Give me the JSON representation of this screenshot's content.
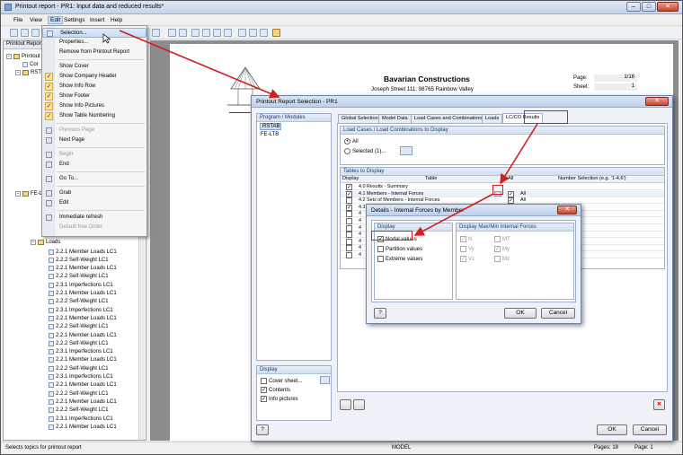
{
  "app": {
    "title": "Printout report - PR1: Input data and reduced results*"
  },
  "menubar": [
    "File",
    "View",
    "Edit",
    "Settings",
    "Insert",
    "Help"
  ],
  "left_panel": {
    "header": "Printout Report",
    "tree": [
      {
        "label": "Printout",
        "kind": "folder"
      },
      {
        "label": "Cor",
        "kind": "doc"
      },
      {
        "label": "RST",
        "kind": "folder"
      },
      {
        "label": "FE-L",
        "kind": "folder"
      },
      {
        "label": "Loads",
        "kind": "folder"
      }
    ],
    "load_items": [
      "2.2.1 Member Loads LC1",
      "2.2.2 Self-Weight LC1",
      "2.2.1 Member Loads LC1",
      "2.2.2 Self-Weight LC1",
      "2.3.1 Imperfections LC1",
      "2.2.1 Member Loads LC1",
      "2.2.2 Self-Weight LC1",
      "2.3.1 Imperfections LC1",
      "2.2.1 Member Loads LC1",
      "2.2.2 Self-Weight LC1",
      "2.2.1 Member Loads LC1",
      "2.2.2 Self-Weight LC1",
      "2.3.1 Imperfections LC1",
      "2.2.1 Member Loads LC1",
      "2.2.2 Self-Weight LC1",
      "2.3.1 Imperfections LC1",
      "2.2.1 Member Loads LC1",
      "2.2.2 Self-Weight LC1",
      "2.2.1 Member Loads LC1",
      "2.2.2 Self-Weight LC1",
      "2.3.1 Imperfections LC1",
      "2.2.1 Member Loads LC1"
    ]
  },
  "edit_menu": [
    {
      "label": "Selection...",
      "state": "hl",
      "icon": true
    },
    {
      "label": "Properties...",
      "state": "normal"
    },
    {
      "label": "Remove from Printout Report",
      "state": "normal"
    },
    {
      "sep": true
    },
    {
      "label": "Show Cover",
      "state": "normal"
    },
    {
      "label": "Show Company Header",
      "state": "check"
    },
    {
      "label": "Show Info Row",
      "state": "check"
    },
    {
      "label": "Show Footer",
      "state": "check"
    },
    {
      "label": "Show Info Pictures",
      "state": "check"
    },
    {
      "label": "Show Table Numbering",
      "state": "check"
    },
    {
      "sep": true
    },
    {
      "label": "Previous Page",
      "state": "dis",
      "icon": true
    },
    {
      "label": "Next Page",
      "state": "normal",
      "icon": true
    },
    {
      "sep": true
    },
    {
      "label": "Begin",
      "state": "dis",
      "icon": true
    },
    {
      "label": "End",
      "state": "normal",
      "icon": true
    },
    {
      "sep": true
    },
    {
      "label": "Go To...",
      "state": "normal",
      "icon": true
    },
    {
      "sep": true
    },
    {
      "label": "Grab",
      "state": "normal",
      "icon": true
    },
    {
      "label": "Edit",
      "state": "normal",
      "icon": true
    },
    {
      "sep": true
    },
    {
      "label": "Immediate refresh",
      "state": "normal",
      "icon": true
    },
    {
      "label": "Default free Order",
      "state": "dis"
    }
  ],
  "paper": {
    "company": "Bavarian Constructions",
    "address": "Joseph Street 111; 98765 Rainbow Valley",
    "page_label": "Page:",
    "page_value": "1/18",
    "sheet_label": "Sheet:",
    "sheet_value": "1"
  },
  "dialog": {
    "title": "Printout Report Selection - PR1",
    "modules_header": "Program / Modules",
    "modules": [
      "RSTAB",
      "FE-LTB"
    ],
    "tabs": [
      "Global Selection",
      "Model Data",
      "Load Cases and Combinations",
      "Loads",
      "LC/CO Results"
    ],
    "lc_header": "Load Cases / Load Combinations to Display",
    "radio_all": "All",
    "radio_selected": "Selected (1)...",
    "tables_header": "Tables to Display",
    "col_display": "Display",
    "col_table": "Table",
    "col_all": "All",
    "col_numsel": "Number Selection (e.g. '1-4,6')",
    "rows": [
      {
        "check": "✓",
        "table": "4.0 Results - Summary",
        "all": "",
        "num": ""
      },
      {
        "check": "✓",
        "table": "4.1 Members - Internal Forces",
        "all": "✓",
        "num": "All"
      },
      {
        "check": "",
        "table": "4.2 Sets of Members - Internal Forces",
        "all": "✓",
        "num": "All"
      },
      {
        "check": "✓",
        "table": "4.3",
        "all": "",
        "num": ""
      },
      {
        "check": "",
        "table": "4",
        "all": "",
        "num": ""
      },
      {
        "check": "",
        "table": "4",
        "all": "",
        "num": ""
      },
      {
        "check": "",
        "table": "4",
        "all": "",
        "num": ""
      },
      {
        "check": "",
        "table": "4",
        "all": "",
        "num": ""
      },
      {
        "check": "",
        "table": "4",
        "all": "",
        "num": ""
      },
      {
        "check": "",
        "table": "4",
        "all": "",
        "num": ""
      },
      {
        "check": "",
        "table": "4",
        "all": "",
        "num": ""
      }
    ],
    "display_header": "Display",
    "display_opts": [
      {
        "label": "Cover sheet...",
        "checked": ""
      },
      {
        "label": "Contents",
        "checked": "✓"
      },
      {
        "label": "Info pictures",
        "checked": "✓"
      }
    ],
    "ok": "OK",
    "cancel": "Cancel"
  },
  "details": {
    "title": "Details - Internal Forces by Member",
    "display_header": "Display",
    "options": [
      {
        "label": "Nodal values",
        "checked": "✓"
      },
      {
        "label": "Partition values",
        "checked": ""
      },
      {
        "label": "Extreme values",
        "checked": ""
      }
    ],
    "maxmin_header": "Display Max/Min Internal Forces",
    "forces_left": [
      {
        "label": "N",
        "checked": "✓"
      },
      {
        "label": "Vy",
        "checked": ""
      },
      {
        "label": "Vz",
        "checked": "✓"
      }
    ],
    "forces_right": [
      {
        "label": "MT",
        "checked": ""
      },
      {
        "label": "My",
        "checked": "✓"
      },
      {
        "label": "Mz",
        "checked": ""
      }
    ],
    "ok": "OK",
    "cancel": "Cancel"
  },
  "status": {
    "left": "Selects topics for printout report",
    "mid": "MODEL",
    "pages": "Pages: 18",
    "page": "Page: 1"
  },
  "colors": {
    "accent": "#d21e1e",
    "header_blue": "#1c3a73"
  }
}
